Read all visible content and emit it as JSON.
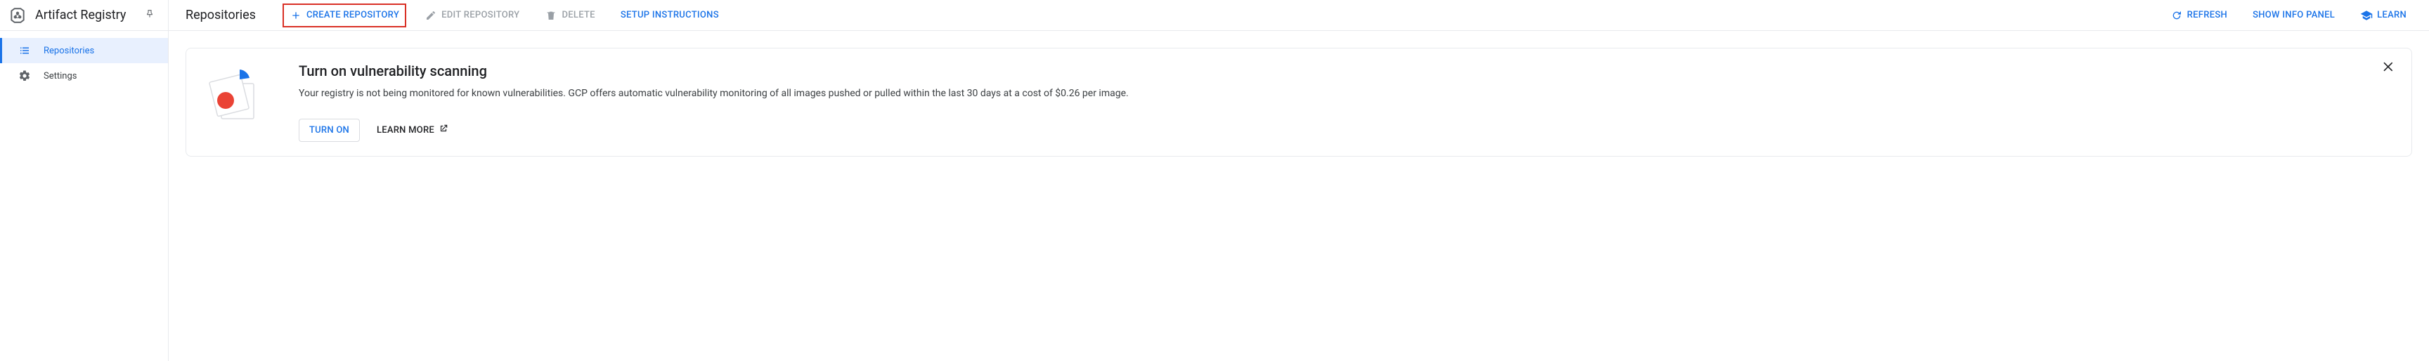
{
  "product": {
    "title": "Artifact Registry"
  },
  "sidebar": {
    "items": [
      {
        "label": "Repositories"
      },
      {
        "label": "Settings"
      }
    ]
  },
  "page": {
    "title": "Repositories"
  },
  "actions": {
    "create": "CREATE REPOSITORY",
    "edit": "EDIT REPOSITORY",
    "delete": "DELETE",
    "setup": "SETUP INSTRUCTIONS",
    "refresh": "REFRESH",
    "show_info": "SHOW INFO PANEL",
    "learn": "LEARN"
  },
  "banner": {
    "title": "Turn on vulnerability scanning",
    "description": "Your registry is not being monitored for known vulnerabilities. GCP offers automatic vulnerability monitoring of all images pushed or pulled within the last 30 days at a cost of $0.26 per image.",
    "turn_on": "TURN ON",
    "learn_more": "LEARN MORE"
  }
}
